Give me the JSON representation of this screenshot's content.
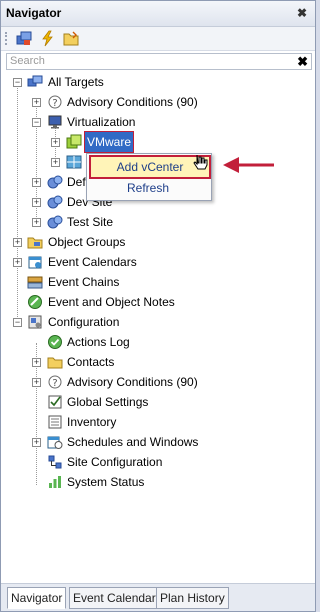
{
  "panel": {
    "title": "Navigator",
    "pin_glyph": "✖"
  },
  "search": {
    "placeholder": "Search",
    "clear_glyph": "✖"
  },
  "toolbar": {
    "icons": [
      "targets-icon",
      "lightning-icon",
      "folder-icon"
    ]
  },
  "tree": {
    "all_targets": "All Targets",
    "advisory_conditions": "Advisory Conditions (90)",
    "virtualization": "Virtualization",
    "vmware": "VMware",
    "item_def": "Def",
    "dev_site": "Dev Site",
    "test_site": "Test Site",
    "object_groups": "Object Groups",
    "event_calendars": "Event Calendars",
    "event_chains": "Event Chains",
    "event_object_notes": "Event and Object Notes",
    "configuration": "Configuration",
    "actions_log": "Actions Log",
    "contacts": "Contacts",
    "advisory_conditions_2": "Advisory Conditions (90)",
    "global_settings": "Global Settings",
    "inventory": "Inventory",
    "schedules_windows": "Schedules and Windows",
    "site_configuration": "Site Configuration",
    "system_status": "System Status"
  },
  "context_menu": {
    "add_vcenter": "Add vCenter",
    "refresh": "Refresh"
  },
  "tabs": {
    "navigator": "Navigator",
    "event_calendar": "Event Calendar",
    "plan_history": "Plan History"
  },
  "colors": {
    "selection": "#316ac5",
    "highlight_border": "#c21f3a",
    "menu_highlight": "#fff4b8"
  }
}
